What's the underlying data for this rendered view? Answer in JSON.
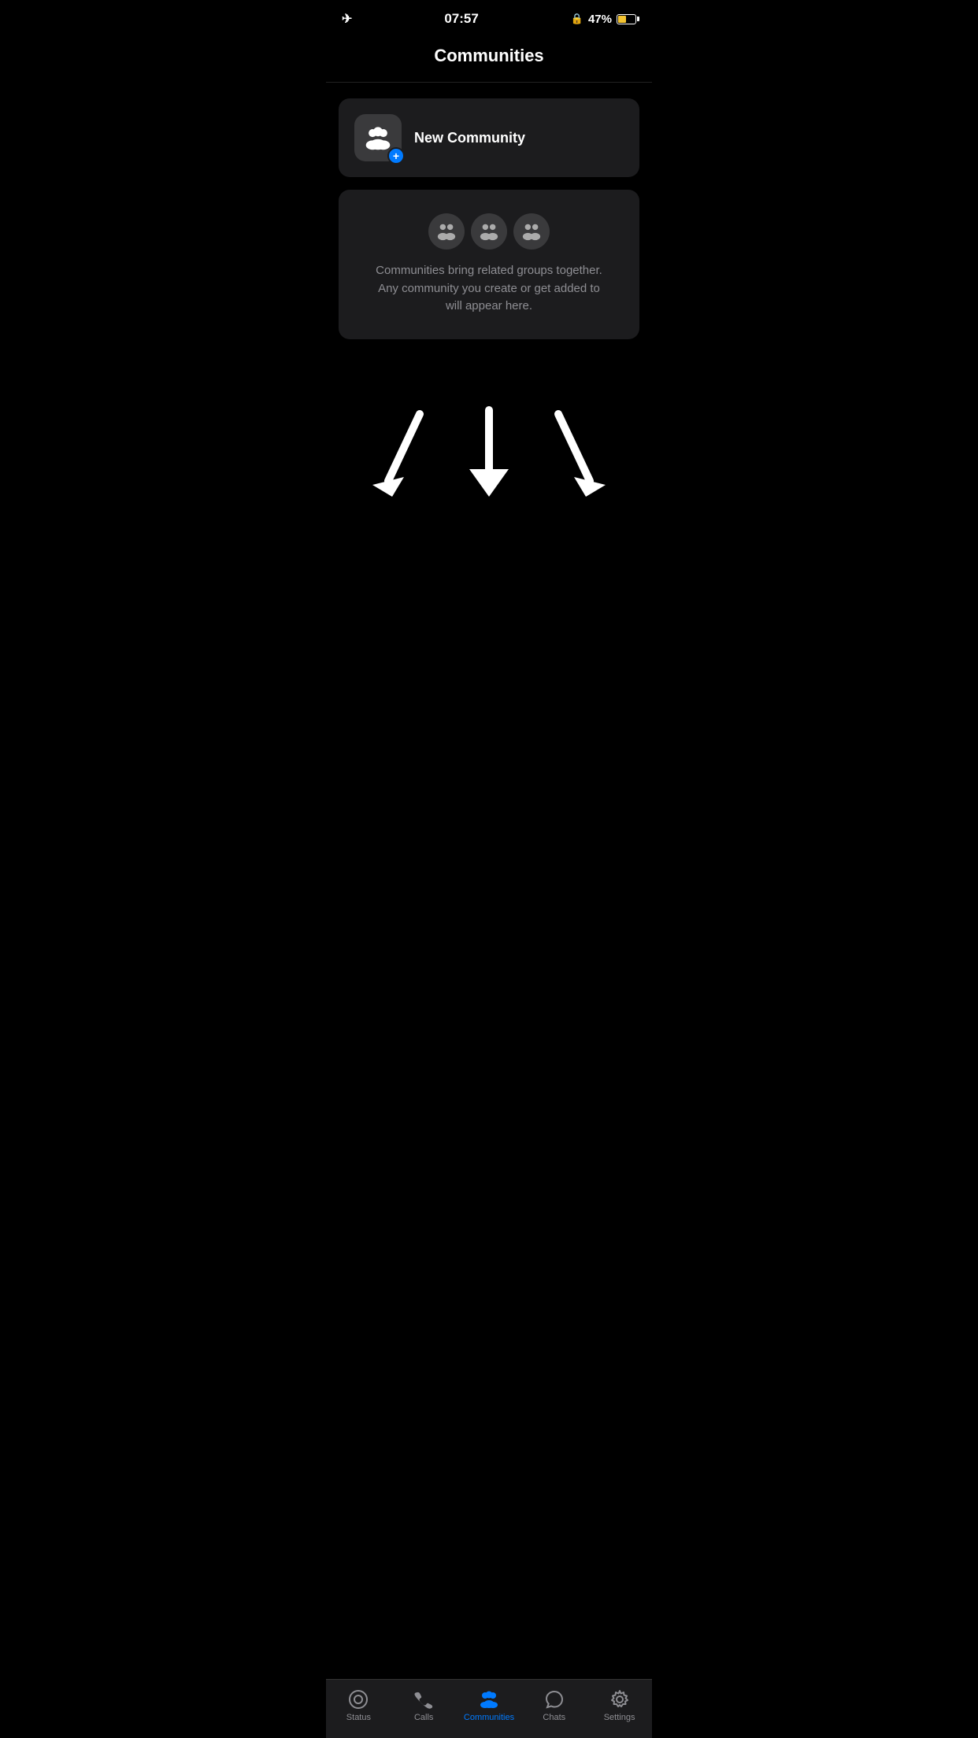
{
  "statusBar": {
    "time": "07:57",
    "battery": "47%",
    "batteryLevel": 47
  },
  "header": {
    "title": "Communities"
  },
  "newCommunity": {
    "label": "New Community",
    "plusIcon": "+"
  },
  "infoCard": {
    "description": "Communities bring related groups together. Any community you create or get added to will appear here."
  },
  "bottomNav": {
    "items": [
      {
        "id": "status",
        "label": "Status",
        "active": false
      },
      {
        "id": "calls",
        "label": "Calls",
        "active": false
      },
      {
        "id": "communities",
        "label": "Communities",
        "active": true
      },
      {
        "id": "chats",
        "label": "Chats",
        "active": false
      },
      {
        "id": "settings",
        "label": "Settings",
        "active": false
      }
    ]
  }
}
